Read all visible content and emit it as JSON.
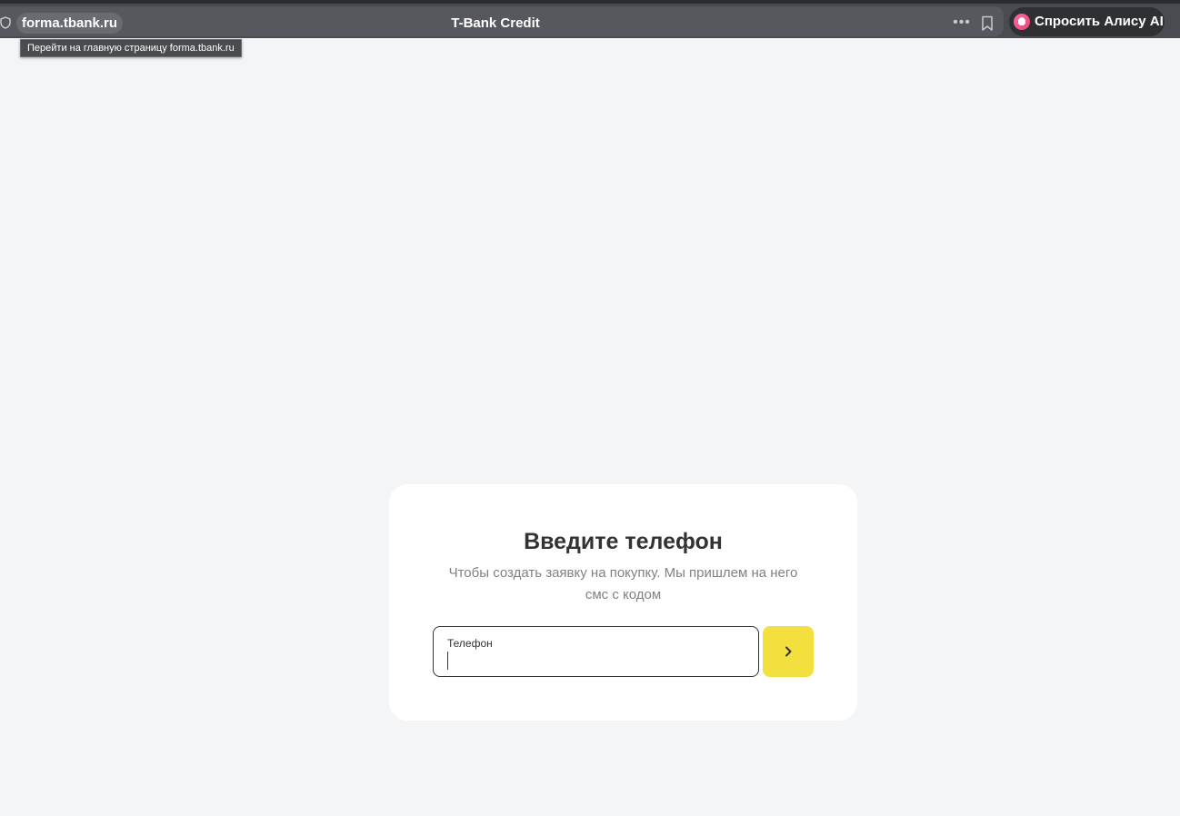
{
  "browser": {
    "url": "forma.tbank.ru",
    "tab_title": "T-Bank Credit",
    "tooltip": "Перейти на главную страницу forma.tbank.ru",
    "alice_button_label": "Спросить Алису AI",
    "icons": {
      "security": "shield-icon",
      "more": "more-dots-icon",
      "bookmark": "bookmark-icon",
      "alice": "alice-logo-icon"
    }
  },
  "form": {
    "title": "Введите телефон",
    "subtitle_line1": "Чтобы создать заявку на покупку. Мы пришлем на него",
    "subtitle_line2": "смс с кодом",
    "phone_label": "Телефон",
    "phone_value": "",
    "submit_icon": "chevron-right-icon",
    "accent_color": "#f3e03f"
  }
}
